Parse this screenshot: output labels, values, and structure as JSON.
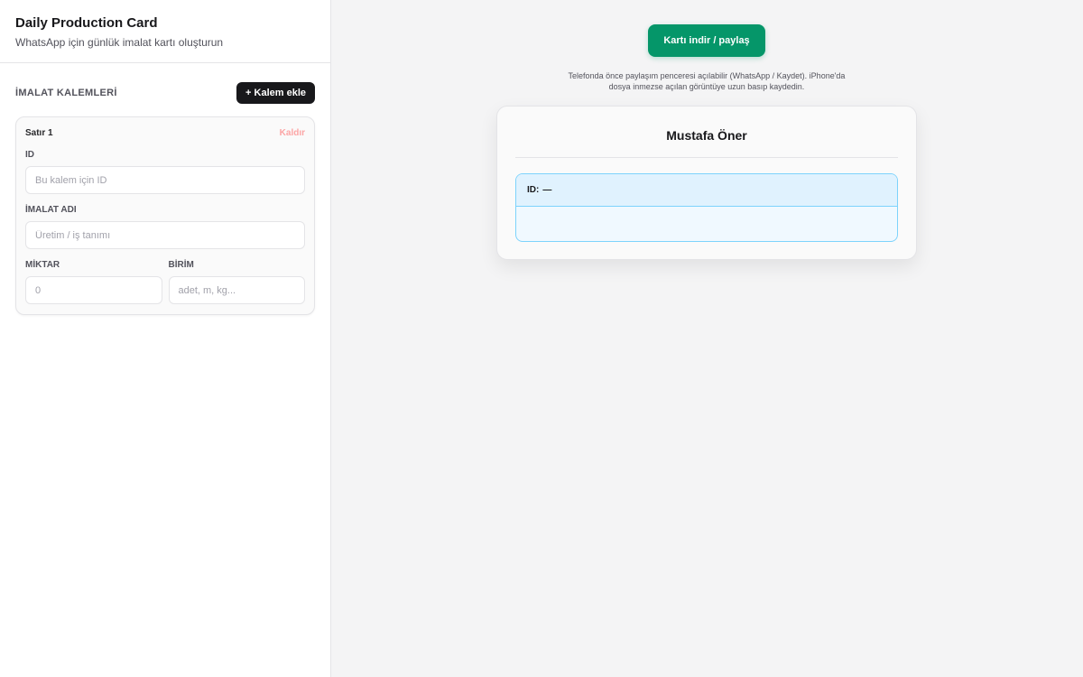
{
  "header": {
    "title": "Daily Production Card",
    "subtitle": "WhatsApp için günlük imalat kartı oluşturun"
  },
  "items_section": {
    "title": "İMALAT KALEMLERİ",
    "add_button": "+ Kalem ekle"
  },
  "item_card": {
    "row_label": "Satır 1",
    "remove_label": "Kaldır",
    "id_label": "ID",
    "id_placeholder": "Bu kalem için ID",
    "id_value": "",
    "name_label": "İMALAT ADI",
    "name_placeholder": "Üretim / iş tanımı",
    "name_value": "",
    "quantity_label": "MİKTAR",
    "quantity_placeholder": "0",
    "quantity_value": "",
    "unit_label": "BİRİM",
    "unit_placeholder": "adet, m, kg...",
    "unit_value": ""
  },
  "main": {
    "share_button": "Kartı indir / paylaş",
    "hint_line1": "Telefonda önce paylaşım penceresi açılabilir (WhatsApp / Kaydet). iPhone'da",
    "hint_line2": "dosya inmezse açılan görüntüye uzun basıp kaydedin."
  },
  "preview": {
    "name": "Mustafa Öner",
    "item_id_label": "ID:",
    "item_id_value": "—"
  },
  "colors": {
    "accent_green": "#059669",
    "dark_button": "#18181b",
    "remove_red": "#fca5a5",
    "preview_item_border": "#7dd3fc",
    "preview_item_bg": "#e0f2fe"
  }
}
